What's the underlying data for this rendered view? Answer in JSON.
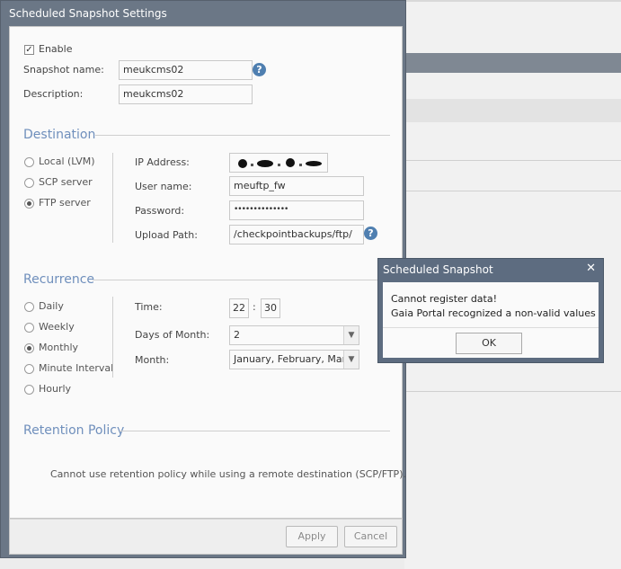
{
  "dialog": {
    "title": "Scheduled Snapshot Settings",
    "enable_label": "Enable",
    "enable_checked": true,
    "snapshot_name_label": "Snapshot name:",
    "snapshot_name_value": "meukcms02",
    "description_label": "Description:",
    "description_value": "meukcms02",
    "help_icon": "?"
  },
  "destination": {
    "heading": "Destination",
    "options": [
      "Local (LVM)",
      "SCP server",
      "FTP server"
    ],
    "selected": "FTP server",
    "ip_label": "IP Address:",
    "ip_value": "",
    "user_label": "User name:",
    "user_value": "meuftp_fw",
    "password_label": "Password:",
    "password_value": "••••••••••••••",
    "path_label": "Upload Path:",
    "path_value": "/checkpointbackups/ftp/"
  },
  "recurrence": {
    "heading": "Recurrence",
    "options": [
      "Daily",
      "Weekly",
      "Monthly",
      "Minute Interval",
      "Hourly"
    ],
    "selected": "Monthly",
    "time_label": "Time:",
    "time_hour": "22",
    "time_sep": ":",
    "time_minute": "30",
    "days_label": "Days of Month:",
    "days_value": "2",
    "month_label": "Month:",
    "month_value": "January, February, March"
  },
  "retention": {
    "heading": "Retention Policy",
    "note": "Cannot use retention policy while using a remote destination (SCP/FTP)."
  },
  "footer": {
    "apply_label": "Apply",
    "cancel_label": "Cancel"
  },
  "alert": {
    "title": "Scheduled Snapshot",
    "close_glyph": "✕",
    "line1": "Cannot register data!",
    "line2": "Gaia Portal recognized a non-valid values",
    "ok_label": "OK"
  },
  "colors": {
    "dialog_frame": "#6b7786",
    "section_heading": "#6f8fbc",
    "alert_frame": "#5d6c80"
  }
}
